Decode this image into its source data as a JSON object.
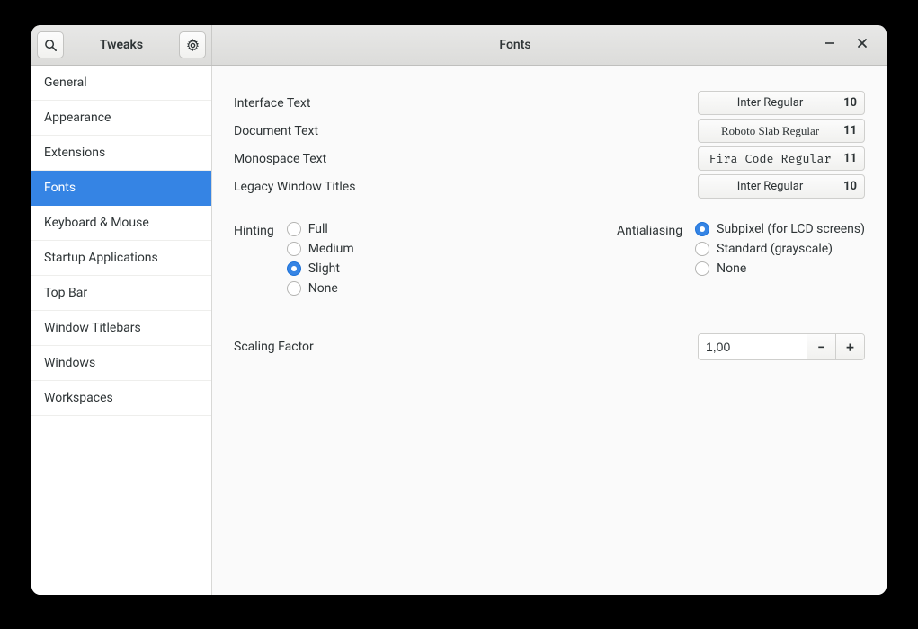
{
  "header": {
    "left_title": "Tweaks",
    "right_title": "Fonts"
  },
  "sidebar": {
    "items": [
      {
        "label": "General",
        "active": false
      },
      {
        "label": "Appearance",
        "active": false
      },
      {
        "label": "Extensions",
        "active": false
      },
      {
        "label": "Fonts",
        "active": true
      },
      {
        "label": "Keyboard & Mouse",
        "active": false
      },
      {
        "label": "Startup Applications",
        "active": false
      },
      {
        "label": "Top Bar",
        "active": false
      },
      {
        "label": "Window Titlebars",
        "active": false
      },
      {
        "label": "Windows",
        "active": false
      },
      {
        "label": "Workspaces",
        "active": false
      }
    ]
  },
  "fonts": {
    "rows": [
      {
        "label": "Interface Text",
        "font": "Inter Regular",
        "size": "10",
        "variant": "sans"
      },
      {
        "label": "Document Text",
        "font": "Roboto Slab Regular",
        "size": "11",
        "variant": "serif"
      },
      {
        "label": "Monospace Text",
        "font": "Fira Code Regular",
        "size": "11",
        "variant": "mono"
      },
      {
        "label": "Legacy Window Titles",
        "font": "Inter Regular",
        "size": "10",
        "variant": "sans"
      }
    ]
  },
  "hinting": {
    "label": "Hinting",
    "options": [
      {
        "label": "Full",
        "checked": false
      },
      {
        "label": "Medium",
        "checked": false
      },
      {
        "label": "Slight",
        "checked": true
      },
      {
        "label": "None",
        "checked": false
      }
    ]
  },
  "antialiasing": {
    "label": "Antialiasing",
    "options": [
      {
        "label": "Subpixel (for LCD screens)",
        "checked": true
      },
      {
        "label": "Standard (grayscale)",
        "checked": false
      },
      {
        "label": "None",
        "checked": false
      }
    ]
  },
  "scaling": {
    "label": "Scaling Factor",
    "value": "1,00"
  }
}
